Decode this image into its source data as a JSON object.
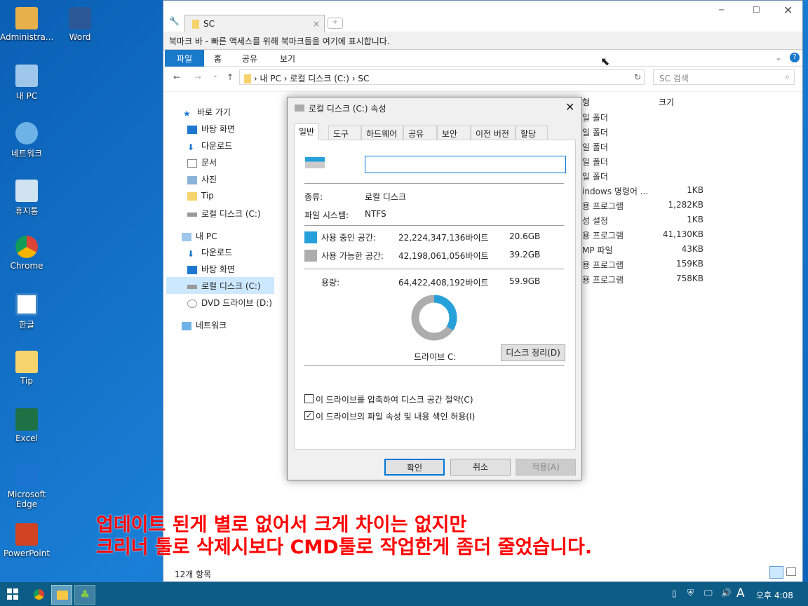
{
  "desktop": {
    "icons": [
      {
        "label": "Administra...",
        "icon": "user-icon"
      },
      {
        "label": "Word",
        "icon": "word-icon"
      },
      {
        "label": "내 PC",
        "icon": "pc-icon"
      },
      {
        "label": "네트워크",
        "icon": "network-icon"
      },
      {
        "label": "휴지통",
        "icon": "recycle-bin-icon"
      },
      {
        "label": "Chrome",
        "icon": "chrome-icon"
      },
      {
        "label": "한글",
        "icon": "hwp-icon"
      },
      {
        "label": "Tip",
        "icon": "folder-icon"
      },
      {
        "label": "Excel",
        "icon": "excel-icon"
      },
      {
        "label": "Microsoft Edge",
        "icon": "edge-icon"
      },
      {
        "label": "PowerPoint",
        "icon": "powerpoint-icon"
      }
    ]
  },
  "explorer": {
    "tab": "SC",
    "bookmark_bar": "북마크 바 - 빠른 액세스를 위해 북마크들을 여기에 표시합니다.",
    "ribbon": {
      "file": "파일",
      "tabs": [
        "홈",
        "공유",
        "보기"
      ]
    },
    "address": {
      "parts": [
        "내 PC",
        "로컬 디스크 (C:)",
        "SC"
      ]
    },
    "search_placeholder": "SC 검색",
    "columns": {
      "type": "형",
      "size": "크기"
    },
    "nav": [
      {
        "label": "바로 가기"
      },
      {
        "label": "바탕 화면"
      },
      {
        "label": "다운로드"
      },
      {
        "label": "문서"
      },
      {
        "label": "사진"
      },
      {
        "label": "Tip"
      },
      {
        "label": "로컬 디스크 (C:)"
      },
      {
        "label": "내 PC"
      },
      {
        "label": "다운로드"
      },
      {
        "label": "바탕 화면"
      },
      {
        "label": "로컬 디스크 (C:)"
      },
      {
        "label": "DVD 드라이브 (D:)"
      },
      {
        "label": "네트워크"
      }
    ],
    "rows": [
      {
        "type": "일 폴더",
        "size": ""
      },
      {
        "type": "일 폴더",
        "size": ""
      },
      {
        "type": "일 폴더",
        "size": ""
      },
      {
        "type": "일 폴더",
        "size": ""
      },
      {
        "type": "일 폴더",
        "size": ""
      },
      {
        "type": "indows 명령어 ...",
        "size": "1KB"
      },
      {
        "type": "용 프로그램",
        "size": "1,282KB"
      },
      {
        "type": "성 설정",
        "size": "1KB"
      },
      {
        "type": "용 프로그램",
        "size": "41,130KB"
      },
      {
        "type": "MP 파일",
        "size": "43KB"
      },
      {
        "type": "용 프로그램",
        "size": "159KB"
      },
      {
        "type": "용 프로그램",
        "size": "758KB"
      }
    ],
    "status": "12개 항목"
  },
  "dialog": {
    "title": "로컬 디스크 (C:) 속성",
    "tabs": [
      "일반",
      "도구",
      "하드웨어",
      "공유",
      "보안",
      "이전 버전",
      "할당량"
    ],
    "name_value": "",
    "type_label": "종류:",
    "type_value": "로컬 디스크",
    "fs_label": "파일 시스템:",
    "fs_value": "NTFS",
    "used_label": "사용 중인 공간:",
    "used_bytes": "22,224,347,136바이트",
    "used_gb": "20.6GB",
    "free_label": "사용 가능한 공간:",
    "free_bytes": "42,198,061,056바이트",
    "free_gb": "39.2GB",
    "cap_label": "용량:",
    "cap_bytes": "64,422,408,192바이트",
    "cap_gb": "59.9GB",
    "used_fraction": 0.344,
    "used_color": "#26a0da",
    "free_color": "#adadad",
    "drive_label": "드라이브 C:",
    "cleanup": "디스크 정리(D)",
    "compress": "이 드라이브를 압축하여 디스크 공간 절약(C)",
    "compress_checked": false,
    "index": "이 드라이브의 파일 속성 및 내용 색인 허용(I)",
    "index_checked": true,
    "ok": "확인",
    "cancel": "취소",
    "apply": "적용(A)"
  },
  "overlay_text": [
    "업데이트 된게 별로 없어서 크게 차이는 없지만",
    "크리너 툴로 삭제시보다 CMD툴로 작업한게 좀더 줄었습니다."
  ],
  "taskbar": {
    "time": "오후 4:08",
    "ime": "A"
  }
}
